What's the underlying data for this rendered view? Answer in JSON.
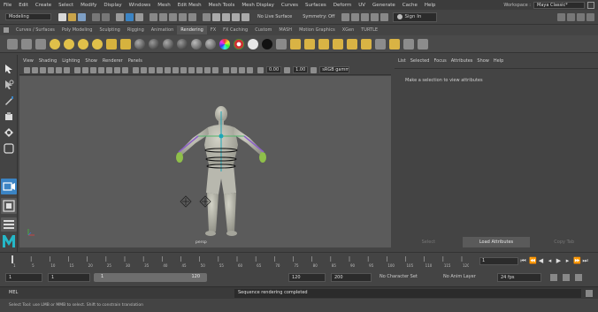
{
  "menubar": {
    "items": [
      "File",
      "Edit",
      "Create",
      "Select",
      "Modify",
      "Display",
      "Windows",
      "Mesh",
      "Edit Mesh",
      "Mesh Tools",
      "Mesh Display",
      "Curves",
      "Surfaces",
      "Deform",
      "UV",
      "Generate",
      "Cache",
      "Help"
    ],
    "workspace_label": "Workspace :",
    "workspace_value": "Maya Classic*"
  },
  "statusline": {
    "mode": "Modeling",
    "live_surface": "No Live Surface",
    "symmetry": "Symmetry: Off",
    "signin": "Sign In"
  },
  "shelf": {
    "tabs": [
      "Curves / Surfaces",
      "Poly Modeling",
      "Sculpting",
      "Rigging",
      "Animation",
      "Rendering",
      "FX",
      "FX Caching",
      "Custom",
      "MASH",
      "Motion Graphics",
      "XGen",
      "TURTLE"
    ],
    "active_tab": "Rendering"
  },
  "viewport": {
    "menu": [
      "View",
      "Shading",
      "Lighting",
      "Show",
      "Renderer",
      "Panels"
    ],
    "near_value": "0.00",
    "far_value": "1.00",
    "colorspace": "sRGB gamma",
    "camera_label": "persp"
  },
  "attribute_editor": {
    "menu": [
      "List",
      "Selected",
      "Focus",
      "Attributes",
      "Show",
      "Help"
    ],
    "message": "Make a selection to view attributes",
    "buttons": [
      "Select",
      "Load Attributes",
      "Copy Tab"
    ]
  },
  "timeslider": {
    "tick_labels": [
      "1",
      "5",
      "10",
      "15",
      "20",
      "25",
      "30",
      "35",
      "40",
      "45",
      "50",
      "55",
      "60",
      "65",
      "70",
      "75",
      "80",
      "85",
      "90",
      "95",
      "100",
      "105",
      "110",
      "115",
      "120"
    ],
    "current_frame": "1"
  },
  "rangeslider": {
    "start_time": "1",
    "range_start": "1",
    "range_handle_start": "1",
    "range_handle_end": "120",
    "range_end": "120",
    "end_time": "200",
    "character_set": "No Character Set",
    "anim_layer": "No Anim Layer",
    "fps": "24 fps"
  },
  "command": {
    "language": "MEL",
    "result": "Sequence rendering completed"
  },
  "helpline": {
    "text": "Select Tool: use LMB or MMB to select. Shift to constrain translation"
  },
  "colors": {
    "accent_blue": "#2e8fd0",
    "selected_icon": "#3b84c4",
    "viewport_bg": "#5b5b5b"
  }
}
